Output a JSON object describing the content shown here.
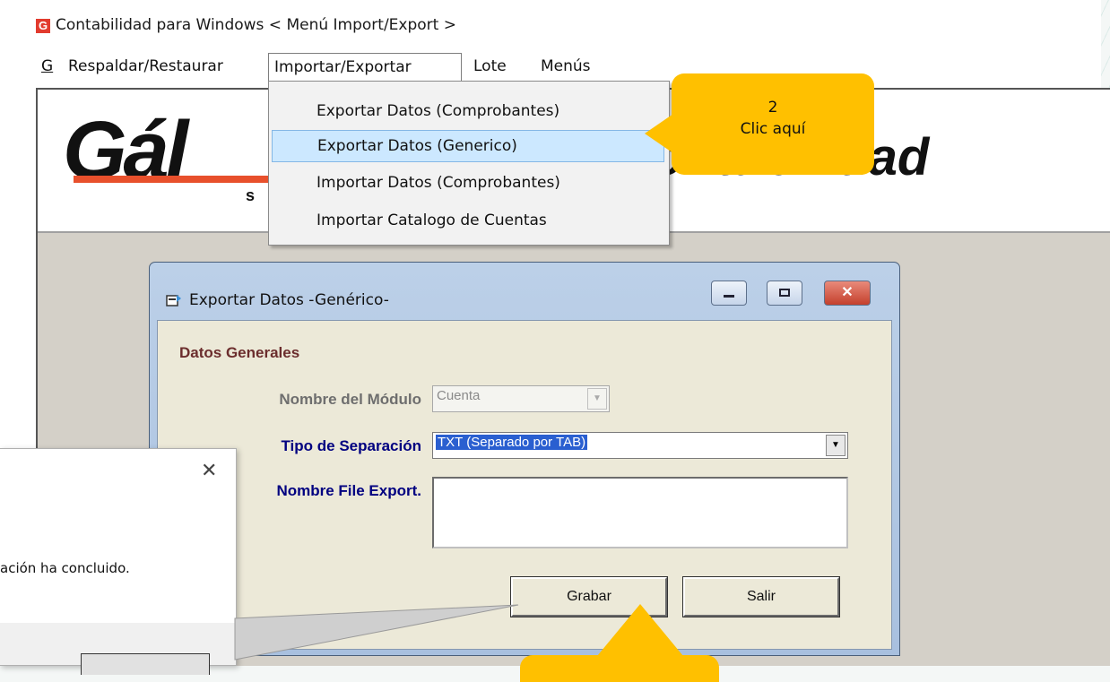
{
  "window": {
    "title": "Contabilidad para Windows < Menú Import/Export >",
    "app_icon_letter": "G"
  },
  "menubar": {
    "items": [
      {
        "label": "G"
      },
      {
        "label": "Respaldar/Restaurar"
      },
      {
        "label": "Importar/Exportar",
        "open": true
      },
      {
        "label": "Lote"
      },
      {
        "label": "Menús"
      }
    ]
  },
  "banner": {
    "logo_left": "Gál",
    "logo_s": "s",
    "logo_right": "ontabilidad"
  },
  "dropdown": {
    "items": [
      {
        "label": "Exportar Datos (Comprobantes)"
      },
      {
        "label": "Exportar Datos (Generico)",
        "highlighted": true
      },
      {
        "label": "Importar Datos (Comprobantes)"
      },
      {
        "label": "Importar Catalogo de Cuentas"
      }
    ]
  },
  "callout_2": {
    "number": "2",
    "text": "Clic aquí",
    "color": "#ffc000"
  },
  "dialog": {
    "title": "Exportar Datos -Genérico-",
    "section_title": "Datos Generales",
    "modulo_label": "Nombre del Módulo",
    "modulo_value": "Cuenta",
    "separacion_label": "Tipo de Separación",
    "separacion_value": "TXT (Separado por TAB)",
    "file_label": "Nombre File Export.",
    "file_value": "",
    "grabar_label": "Grabar",
    "salir_label": "Salir"
  },
  "message_box": {
    "close_glyph": "✕",
    "text": "ación ha concluido."
  },
  "colors": {
    "accent_callout": "#ffc000",
    "section_title": "#6b2d2d",
    "field_label_active": "#000080",
    "highlight": "#cce8ff"
  }
}
